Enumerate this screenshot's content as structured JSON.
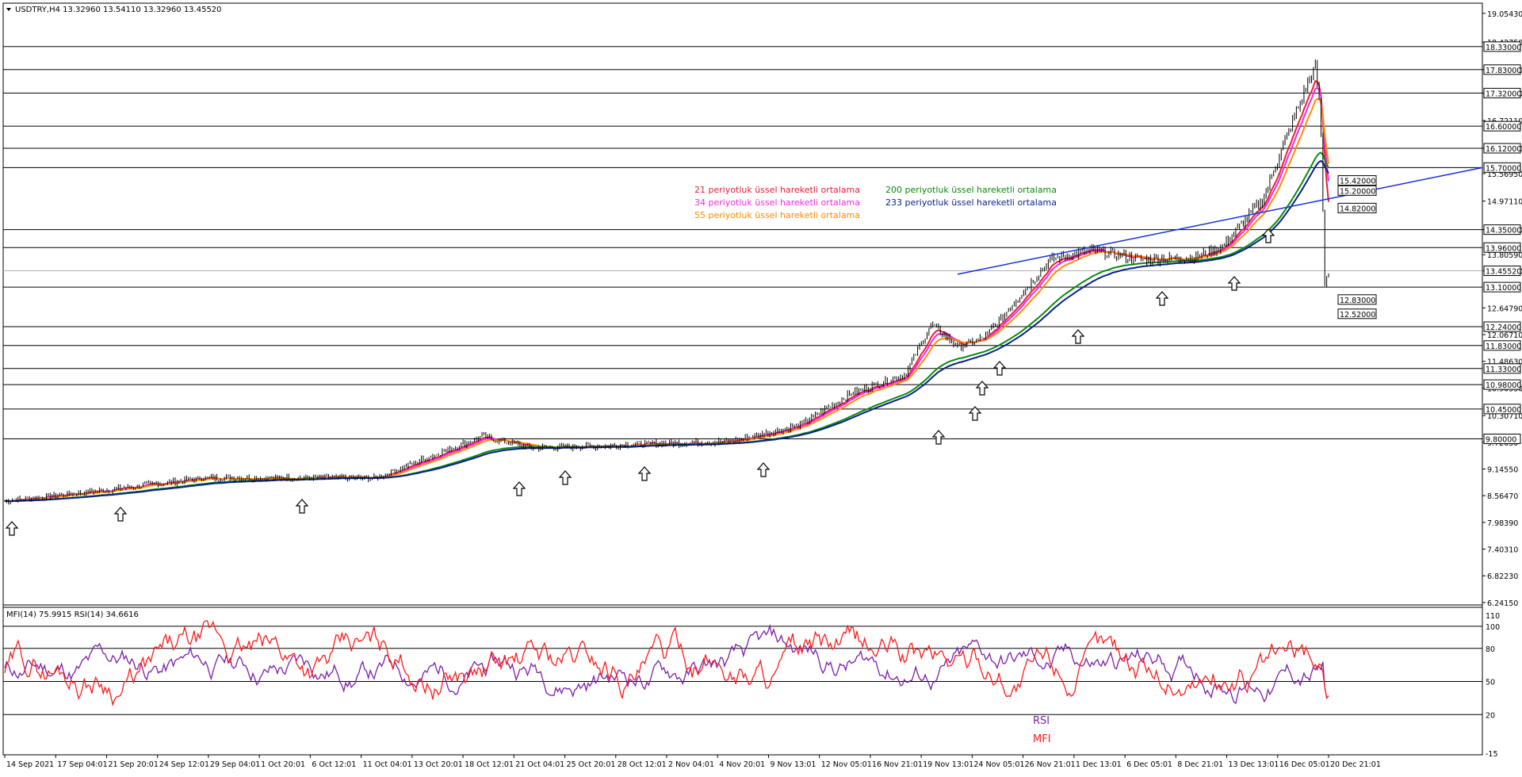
{
  "header": {
    "symbol_info": "USDTRY,H4  13.32960 13.54110 13.32960 13.45520"
  },
  "price_axis": {
    "tick_labels": [
      "19.05430",
      "18.42750",
      "17.83000",
      "17.32000",
      "16.72110",
      "16.12000",
      "15.56950",
      "14.97110",
      "14.35000",
      "13.80590",
      "13.45520",
      "12.64790",
      "12.06710",
      "11.48630",
      "10.90550",
      "10.30710",
      "9.72630",
      "9.14550",
      "8.56470",
      "7.98390",
      "7.40310",
      "6.82230",
      "6.24150"
    ]
  },
  "horizontal_levels": [
    {
      "label": "18.33000",
      "value": 18.33
    },
    {
      "label": "17.83000",
      "value": 17.83
    },
    {
      "label": "17.32000",
      "value": 17.32
    },
    {
      "label": "16.60000",
      "value": 16.6
    },
    {
      "label": "16.12000",
      "value": 16.12
    },
    {
      "label": "15.70000",
      "value": 15.7
    },
    {
      "label": "14.35000",
      "value": 14.35
    },
    {
      "label": "13.96000",
      "value": 13.96
    },
    {
      "label": "13.45520",
      "value": 13.4552
    },
    {
      "label": "13.10000",
      "value": 13.1
    },
    {
      "label": "12.24000",
      "value": 12.24
    },
    {
      "label": "11.83000",
      "value": 11.83
    },
    {
      "label": "11.33000",
      "value": 11.33
    },
    {
      "label": "10.98000",
      "value": 10.98
    },
    {
      "label": "10.45000",
      "value": 10.45
    },
    {
      "label": "9.80000",
      "value": 9.8
    }
  ],
  "ma_value_boxes": [
    {
      "label": "15.42000",
      "value": 15.42
    },
    {
      "label": "15.20000",
      "value": 15.2
    },
    {
      "label": "14.82000",
      "value": 14.82
    },
    {
      "label": "12.83000",
      "value": 12.83
    },
    {
      "label": "12.52000",
      "value": 12.52
    }
  ],
  "legend": {
    "ema21": "21 periyotluk üssel hareketli ortalama",
    "ema34": "34 periyotluk üssel hareketli ortalama",
    "ema55": "55 periyotluk üssel hareketli ortalama",
    "ema200": "200 periyotluk üssel hareketli ortalama",
    "ema233": "233 periyotluk üssel hareketli ortalama"
  },
  "colors": {
    "ema21": "#e8203a",
    "ema34": "#f02ae6",
    "ema55": "#ff8a00",
    "ema200": "#0a8a10",
    "ema233": "#0b1f8a",
    "trendline": "#1430d8",
    "rsi": "#7a1fa8",
    "mfi": "#ff1a1a",
    "grid": "#000000"
  },
  "indicator": {
    "title": "MFI(14) 75.9915  RSI(14) 34.6616",
    "axis_labels": [
      "110",
      "100",
      "80",
      "50",
      "20",
      "-15"
    ],
    "levels": [
      100,
      80,
      50,
      20
    ],
    "rsi_label": "RSI",
    "mfi_label": "MFI"
  },
  "time_axis": {
    "labels": [
      "14 Sep 2021",
      "17 Sep 04:01",
      "21 Sep 20:01",
      "24 Sep 12:01",
      "29 Sep 04:01",
      "1 Oct 20:01",
      "6 Oct 12:01",
      "11 Oct 04:01",
      "13 Oct 20:01",
      "18 Oct 12:01",
      "21 Oct 04:01",
      "25 Oct 20:01",
      "28 Oct 12:01",
      "2 Nov 04:01",
      "4 Nov 20:01",
      "9 Nov 13:01",
      "12 Nov 05:01",
      "16 Nov 21:01",
      "19 Nov 13:01",
      "24 Nov 05:01",
      "26 Nov 21:01",
      "1 Dec 13:01",
      "6 Dec 05:01",
      "8 Dec 21:01",
      "13 Dec 13:01",
      "16 Dec 05:01",
      "20 Dec 21:01"
    ]
  }
}
